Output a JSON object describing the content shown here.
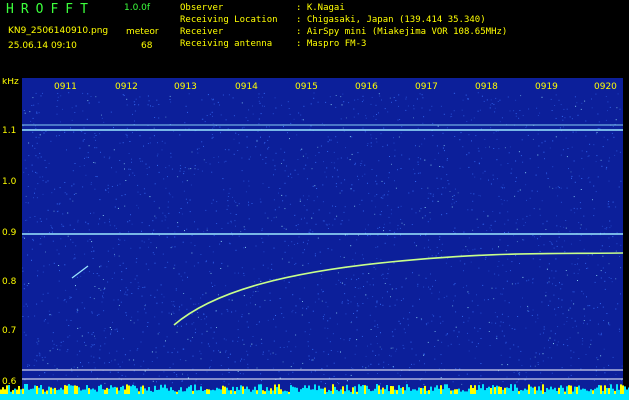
{
  "header": {
    "app_title": "HROFFT",
    "version": "1.0.0f",
    "filename": "KN9_2506140910.png",
    "meteor_label": "meteor",
    "datetime": "25.06.14 09:10",
    "meteor_count": "68",
    "info": [
      {
        "label": "Observer",
        "value": ": K.Nagai"
      },
      {
        "label": "Receiving Location",
        "value": ": Chigasaki, Japan (139.414 35.340)"
      },
      {
        "label": "Receiver",
        "value": ": AirSpy mini (Miakejima VOR 108.65MHz)"
      },
      {
        "label": "Receiving antenna",
        "value": ": Maspro FM-3"
      }
    ]
  },
  "spectrogram": {
    "unit_label": "kHz",
    "y_ticks": [
      "1.1",
      "1.0",
      "0.9",
      "0.8",
      "0.7",
      "0.6"
    ],
    "time_labels": [
      "0911",
      "0912",
      "0913",
      "0914",
      "0915",
      "0916",
      "0917",
      "0918",
      "0919",
      "0920"
    ],
    "colors": {
      "background": "#0c1f9a",
      "noise": "#3a73ff",
      "carrier": "#9be8ff",
      "trail": "#c8ff8a",
      "labels": "#ffff00",
      "bottom_bar": "#00e5ff"
    }
  }
}
